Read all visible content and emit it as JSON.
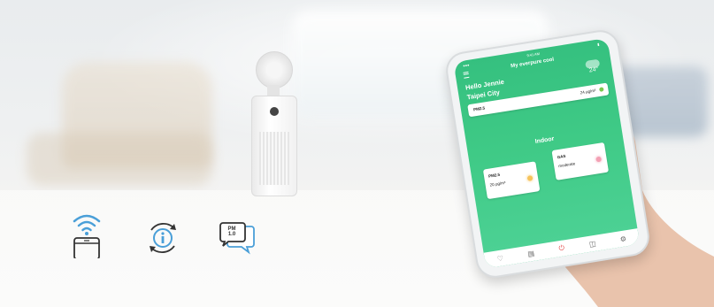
{
  "app": {
    "title": "My everpure cool",
    "status_time": "9:41 AM",
    "greeting": "Hello Jennie",
    "city": "Taipei City",
    "temperature": "24°"
  },
  "outdoor": {
    "label": "PM2.5",
    "value": "24 μg/m³",
    "status_color": "#7bc94c"
  },
  "indoor": {
    "section_title": "Indoor",
    "pm": {
      "label": "PM2.5",
      "value": "20 μg/m³",
      "status_color": "#f6c35b"
    },
    "gas": {
      "label": "GAS",
      "value": "moderate",
      "status_color": "#f3a0b4"
    }
  },
  "navbar": {
    "items": [
      {
        "icon": "heart-icon"
      },
      {
        "icon": "filter-icon"
      },
      {
        "icon": "power-icon"
      },
      {
        "icon": "schedule-icon"
      },
      {
        "icon": "settings-icon"
      }
    ]
  },
  "features": {
    "pm_badge_line1": "PM",
    "pm_badge_line2": "1.0"
  },
  "colors": {
    "app_green": "#3fca86",
    "icon_blue": "#4a9fd8",
    "icon_dark": "#333333"
  }
}
